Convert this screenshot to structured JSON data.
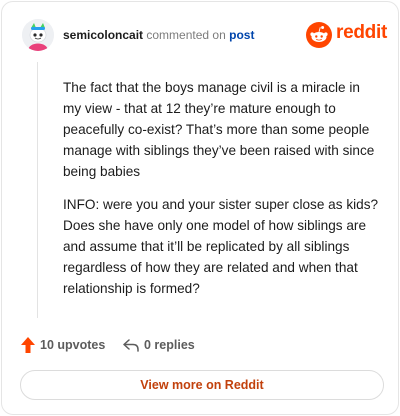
{
  "header": {
    "username": "semicoloncait",
    "action_text": "commented on",
    "post_link": "post",
    "brand_text": "reddit"
  },
  "comment": {
    "paragraphs": [
      "The fact that the boys manage civil is a miracle in my view - that at 12 they’re mature enough to peacefully co-exist? That’s more than some people manage with siblings they’ve been raised with since being babies",
      "INFO: were you and your sister super close as kids? Does she have only one model of how siblings are and assume that it’ll be replicated by all siblings regardless of how they are related and when that relationship is formed?"
    ]
  },
  "actions": {
    "upvotes_label": "10 upvotes",
    "replies_label": "0 replies"
  },
  "footer": {
    "view_more_label": "View more on Reddit"
  },
  "colors": {
    "brand": "#ff4500",
    "link": "#0045ac",
    "cta": "#c2410c"
  },
  "icons": {
    "avatar": "snoo-avatar",
    "brand": "reddit-logo-icon",
    "upvote": "upvote-arrow-icon",
    "reply": "reply-arrow-icon"
  }
}
